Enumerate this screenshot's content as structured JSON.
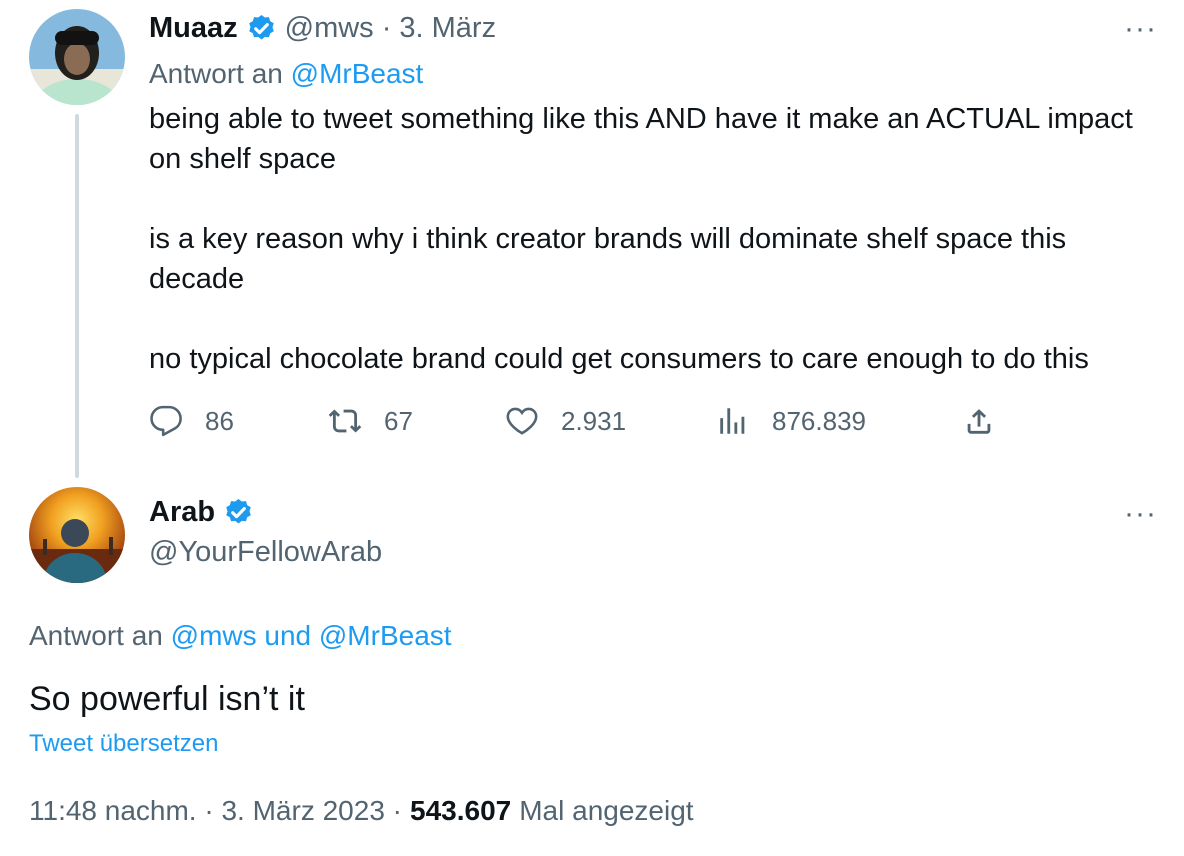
{
  "tweet1": {
    "name": "Muaaz",
    "handle": "@mws",
    "date": "· 3. März",
    "reply_prefix": "Antwort an",
    "reply_to": "@MrBeast",
    "paragraphs": [
      "being able to tweet something like this AND have it make an ACTUAL impact on shelf space",
      "is a key reason why i think creator brands will dominate shelf space this decade",
      "no typical chocolate brand could get consumers to care enough to do this"
    ],
    "actions": {
      "replies": "86",
      "retweets": "67",
      "likes": "2.931",
      "views": "876.839"
    },
    "more_label": "···"
  },
  "tweet2": {
    "name": "Arab",
    "handle": "@YourFellowArab",
    "reply_prefix": "Antwort an",
    "reply_to": "@mws und @MrBeast",
    "text": "So powerful isn’t it",
    "translate": "Tweet übersetzen",
    "time": "11:48 nachm. · 3. März 2023 ·",
    "views_count": "543.607",
    "views_label": "Mal angezeigt",
    "more_label": "···"
  },
  "colors": {
    "accent": "#1d9bf0",
    "muted": "#536471",
    "text": "#0f1419",
    "thread_line": "#cfd9de"
  },
  "icons": [
    "verified-badge-icon",
    "reply-icon",
    "retweet-icon",
    "like-icon",
    "views-icon",
    "share-icon",
    "more-icon"
  ]
}
